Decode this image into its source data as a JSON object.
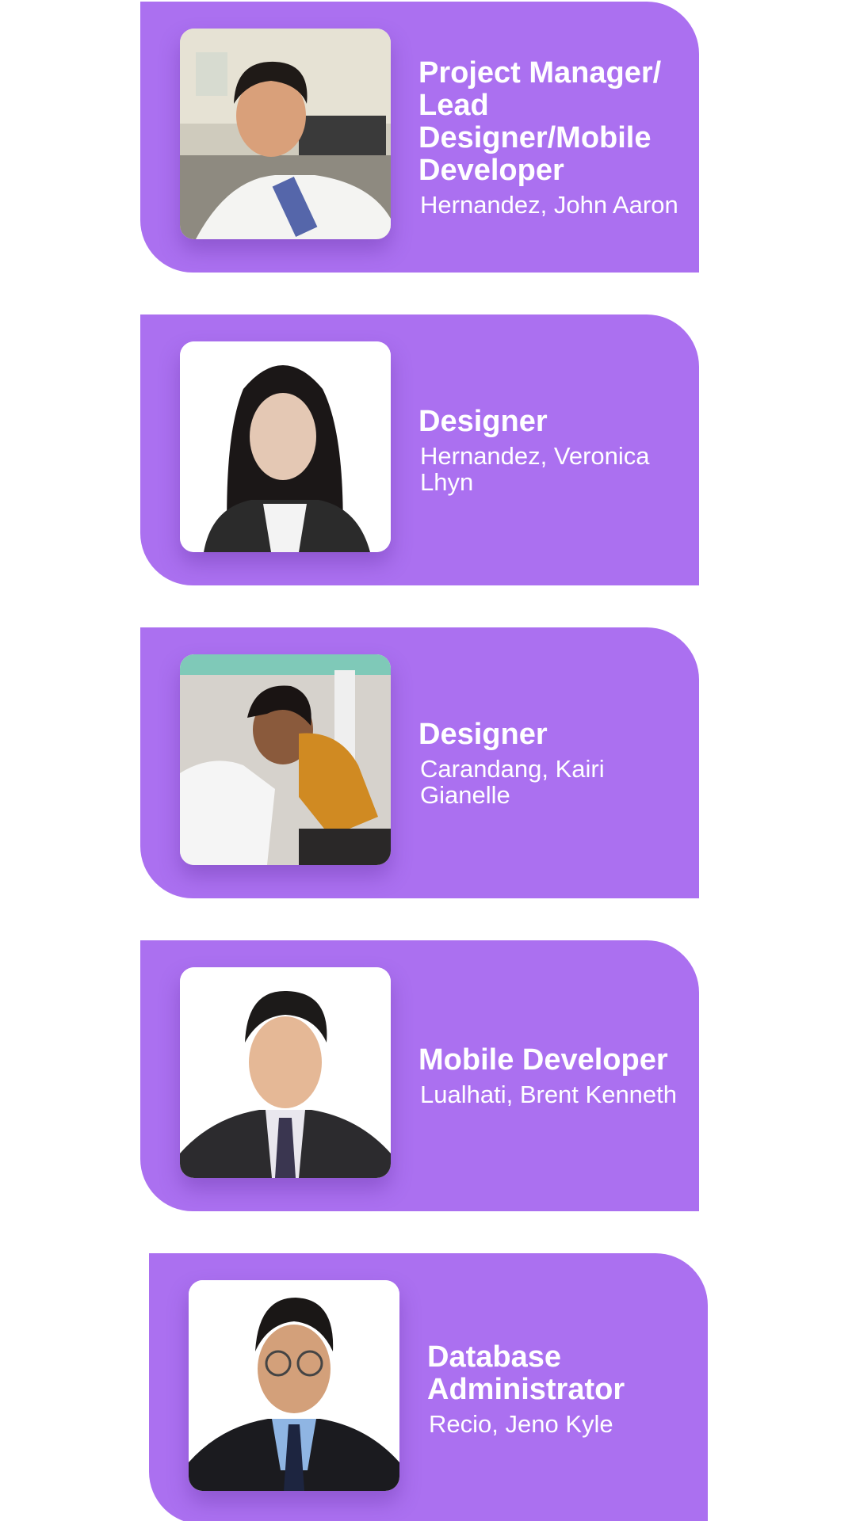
{
  "colors": {
    "card_background": "#AB70F0",
    "text": "#FFFFFF",
    "page_background": "#FFFFFF"
  },
  "team": [
    {
      "role": "Project Manager/ Lead Designer/Mobile Developer",
      "name": "Hernandez, John Aaron",
      "photo_icon": "photo-selfie-icon"
    },
    {
      "role": "Designer",
      "name": "Hernandez, Veronica Lhyn",
      "photo_icon": "photo-portrait-icon"
    },
    {
      "role": "Designer",
      "name": "Carandang, Kairi Gianelle",
      "photo_icon": "photo-candid-icon"
    },
    {
      "role": "Mobile Developer",
      "name": "Lualhati, Brent Kenneth",
      "photo_icon": "photo-portrait-icon"
    },
    {
      "role": "Database Administrator",
      "name": "Recio, Jeno Kyle",
      "photo_icon": "photo-portrait-icon"
    }
  ]
}
